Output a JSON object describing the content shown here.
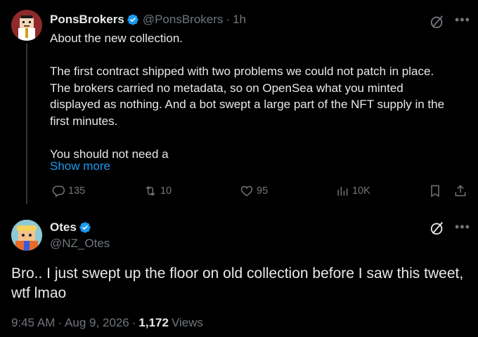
{
  "colors": {
    "background": "#000000",
    "text": "#e7e9ea",
    "muted": "#71767b",
    "link": "#1d9bf0",
    "verified": "#1d9bf0",
    "avatar1_bg": "#8e2a2a",
    "avatar2_bg": "#8ec9d6"
  },
  "tweet": {
    "author_name": "PonsBrokers",
    "author_handle": "@PonsBrokers",
    "separator": "·",
    "time": "1h",
    "lines": [
      "About the new collection.",
      "",
      "The first contract shipped with two problems we could not patch in place.",
      "The brokers carried no metadata, so on OpenSea what you minted",
      "displayed as nothing. And a bot swept a large part of the NFT supply in the",
      "first minutes.",
      "",
      "You should not need a"
    ],
    "show_more": "Show more",
    "actions": {
      "replies": "135",
      "reposts": "10",
      "likes": "95",
      "views": "10K"
    },
    "more_icon": "more-horizontal-icon",
    "grok_icon": "grok-icon"
  },
  "reply": {
    "author_name": "Otes",
    "author_handle": "@NZ_Otes",
    "text": "Bro.. I just swept up the floor on old collection before I saw this tweet, wtf lmao",
    "timestamp": "9:45 AM",
    "date": "Aug 9, 2026",
    "separator": "·",
    "views_count": "1,172",
    "views_label": "Views"
  }
}
